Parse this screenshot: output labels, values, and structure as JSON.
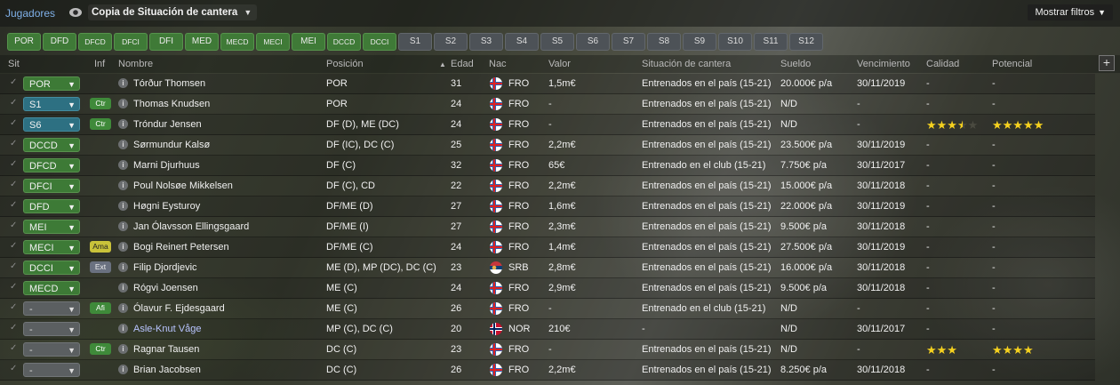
{
  "topbar": {
    "title": "Jugadores",
    "view": "Copia de Situación de cantera",
    "filters": "Mostrar filtros"
  },
  "pills": [
    "POR",
    "DFD",
    "DFCD",
    "DFCI",
    "DFI",
    "MED",
    "MECD",
    "MECI",
    "MEI",
    "DCCD",
    "DCCI",
    "S1",
    "S2",
    "S3",
    "S4",
    "S5",
    "S6",
    "S7",
    "S8",
    "S9",
    "S10",
    "S11",
    "S12"
  ],
  "headers": {
    "sit": "Sit",
    "inf": "Inf",
    "nombre": "Nombre",
    "posicion": "Posición",
    "edad": "Edad",
    "nac": "Nac",
    "valor": "Valor",
    "situacion": "Situación de cantera",
    "sueldo": "Sueldo",
    "vencimiento": "Vencimiento",
    "calidad": "Calidad",
    "potencial": "Potencial"
  },
  "rows": [
    {
      "sit": "POR",
      "inf": "",
      "nombre": "Tórður Thomsen",
      "posicion": "POR",
      "edad": "31",
      "nac": "FRO",
      "valor": "1,5m€",
      "situacion": "Entrenados en el país (15-21)",
      "sueldo": "20.000€ p/a",
      "vencimiento": "30/11/2019",
      "calidad": "-",
      "potencial": "-"
    },
    {
      "sit": "S1",
      "inf": "Ctr",
      "nombre": "Thomas Knudsen",
      "posicion": "POR",
      "edad": "24",
      "nac": "FRO",
      "valor": "-",
      "situacion": "Entrenados en el país (15-21)",
      "sueldo": "N/D",
      "vencimiento": "-",
      "calidad": "-",
      "potencial": "-"
    },
    {
      "sit": "S6",
      "inf": "Ctr",
      "nombre": "Tróndur Jensen",
      "posicion": "DF (D), ME (DC)",
      "edad": "24",
      "nac": "FRO",
      "valor": "-",
      "situacion": "Entrenados en el país (15-21)",
      "sueldo": "N/D",
      "vencimiento": "-",
      "calidad": "",
      "potencial": ""
    },
    {
      "sit": "DCCD",
      "inf": "",
      "nombre": "Sørmundur Kalsø",
      "posicion": "DF (IC), DC (C)",
      "edad": "25",
      "nac": "FRO",
      "valor": "2,2m€",
      "situacion": "Entrenados en el país (15-21)",
      "sueldo": "23.500€ p/a",
      "vencimiento": "30/11/2019",
      "calidad": "-",
      "potencial": "-"
    },
    {
      "sit": "DFCD",
      "inf": "",
      "nombre": "Marni Djurhuus",
      "posicion": "DF (C)",
      "edad": "32",
      "nac": "FRO",
      "valor": "65€",
      "situacion": "Entrenado en el club (15-21)",
      "sueldo": "7.750€ p/a",
      "vencimiento": "30/11/2017",
      "calidad": "-",
      "potencial": "-"
    },
    {
      "sit": "DFCI",
      "inf": "",
      "nombre": "Poul Nolsøe Mikkelsen",
      "posicion": "DF (C), CD",
      "edad": "22",
      "nac": "FRO",
      "valor": "2,2m€",
      "situacion": "Entrenados en el país (15-21)",
      "sueldo": "15.000€ p/a",
      "vencimiento": "30/11/2018",
      "calidad": "-",
      "potencial": "-"
    },
    {
      "sit": "DFD",
      "inf": "",
      "nombre": "Høgni Eysturoy",
      "posicion": "DF/ME (D)",
      "edad": "27",
      "nac": "FRO",
      "valor": "1,6m€",
      "situacion": "Entrenados en el país (15-21)",
      "sueldo": "22.000€ p/a",
      "vencimiento": "30/11/2019",
      "calidad": "-",
      "potencial": "-"
    },
    {
      "sit": "MEI",
      "inf": "",
      "nombre": "Jan Ólavsson Ellingsgaard",
      "posicion": "DF/ME (I)",
      "edad": "27",
      "nac": "FRO",
      "valor": "2,3m€",
      "situacion": "Entrenados en el país (15-21)",
      "sueldo": "9.500€ p/a",
      "vencimiento": "30/11/2018",
      "calidad": "-",
      "potencial": "-"
    },
    {
      "sit": "MECI",
      "inf": "Ama",
      "nombre": "Bogi Reinert Petersen",
      "posicion": "DF/ME (C)",
      "edad": "24",
      "nac": "FRO",
      "valor": "1,4m€",
      "situacion": "Entrenados en el país (15-21)",
      "sueldo": "27.500€ p/a",
      "vencimiento": "30/11/2019",
      "calidad": "-",
      "potencial": "-"
    },
    {
      "sit": "DCCI",
      "inf": "Ext",
      "nombre": "Filip Djordjevic",
      "posicion": "ME (D), MP (DC), DC (C)",
      "edad": "23",
      "nac": "SRB",
      "valor": "2,8m€",
      "situacion": "Entrenados en el país (15-21)",
      "sueldo": "16.000€ p/a",
      "vencimiento": "30/11/2018",
      "calidad": "-",
      "potencial": "-"
    },
    {
      "sit": "MECD",
      "inf": "",
      "nombre": "Rógvi Joensen",
      "posicion": "ME (C)",
      "edad": "24",
      "nac": "FRO",
      "valor": "2,9m€",
      "situacion": "Entrenados en el país (15-21)",
      "sueldo": "9.500€ p/a",
      "vencimiento": "30/11/2018",
      "calidad": "-",
      "potencial": "-"
    },
    {
      "sit": "-",
      "inf": "Afi",
      "nombre": "Ólavur F. Ejdesgaard",
      "posicion": "ME (C)",
      "edad": "26",
      "nac": "FRO",
      "valor": "-",
      "situacion": "Entrenado en el club (15-21)",
      "sueldo": "N/D",
      "vencimiento": "-",
      "calidad": "-",
      "potencial": "-"
    },
    {
      "sit": "-",
      "inf": "",
      "nombre": "Asle-Knut Våge",
      "posicion": "MP (C), DC (C)",
      "edad": "20",
      "nac": "NOR",
      "valor": "210€",
      "situacion": "-",
      "sueldo": "N/D",
      "vencimiento": "30/11/2017",
      "calidad": "-",
      "potencial": "-"
    },
    {
      "sit": "-",
      "inf": "Ctr",
      "nombre": "Ragnar Tausen",
      "posicion": "DC (C)",
      "edad": "23",
      "nac": "FRO",
      "valor": "-",
      "situacion": "Entrenados en el país (15-21)",
      "sueldo": "N/D",
      "vencimiento": "-",
      "calidad": "",
      "potencial": ""
    },
    {
      "sit": "-",
      "inf": "",
      "nombre": "Brian Jacobsen",
      "posicion": "DC (C)",
      "edad": "26",
      "nac": "FRO",
      "valor": "2,2m€",
      "situacion": "Entrenados en el país (15-21)",
      "sueldo": "8.250€ p/a",
      "vencimiento": "30/11/2018",
      "calidad": "-",
      "potencial": "-"
    }
  ],
  "ratings": {
    "row3_calidad_stars": 3.5,
    "row3_potencial_stars": 5,
    "row14_calidad_stars": 3,
    "row14_potencial_stars": 4
  },
  "colors": {
    "accent": "#7fb0e8",
    "position_green": "#3d7a36",
    "position_teal": "#2d7082",
    "star": "#f5d11f"
  }
}
